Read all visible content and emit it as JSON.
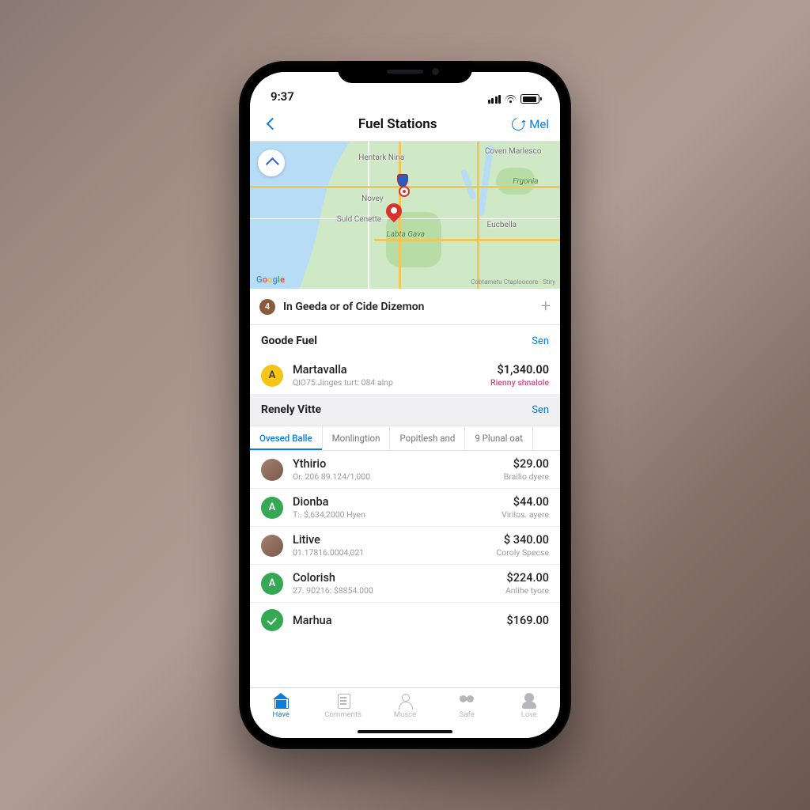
{
  "status": {
    "time": "9:37"
  },
  "header": {
    "title": "Fuel Stations",
    "action": "Mel"
  },
  "map": {
    "labels": {
      "l1": "Hentark Nina",
      "l2": "Coven Marlesco",
      "l3": "Novey",
      "l4": "Suld Cenette",
      "l5": "Eucbella",
      "p1": "Labta Gava",
      "p2": "Frgonia"
    },
    "logo": [
      "G",
      "o",
      "o",
      "g",
      "l",
      "e"
    ],
    "attribution": "Cobtametu Ctaploocore · Stiry"
  },
  "location": {
    "count": "4",
    "text": "In Geeda or of Cide Dizemon"
  },
  "section1": {
    "title": "Goode Fuel",
    "action": "Sen",
    "row": {
      "icon": "A",
      "title": "Martavalla",
      "sub": "QlO75:Jinges turt: 084 alnp",
      "price": "$1,340.00",
      "tag": "Rienny shnalole"
    }
  },
  "section2": {
    "title": "Renely Vitte",
    "action": "Sen"
  },
  "tabs": [
    "Ovesed Balle",
    "Monlingtion",
    "Popitlesh and",
    "9 Plunal oat"
  ],
  "list": [
    {
      "icon": "img",
      "title": "Ythirio",
      "sub": "Or. 206 89.124/1,000",
      "price": "$29.00",
      "tag": "Brailio dyere"
    },
    {
      "icon": "A",
      "color": "#34a853",
      "title": "Dionba",
      "sub": "T:. $,634,2000 Hyen",
      "price": "$44.00",
      "tag": "Virilos. ayere"
    },
    {
      "icon": "img",
      "title": "Litive",
      "sub": "01.17816.0004,021",
      "price": "$ 340.00",
      "tag": "Coroly Specse"
    },
    {
      "icon": "A",
      "color": "#34a853",
      "title": "Colorish",
      "sub": "27. 90216: $8854.000",
      "price": "$224.00",
      "tag": "Anlihe tyore"
    },
    {
      "icon": "check",
      "title": "Marhua",
      "sub": "",
      "price": "$169.00",
      "tag": ""
    }
  ],
  "tabbar": [
    {
      "icon": "home",
      "label": "Have",
      "active": true
    },
    {
      "icon": "doc",
      "label": "Comments"
    },
    {
      "icon": "user",
      "label": "Musce"
    },
    {
      "icon": "heart",
      "label": "Safe"
    },
    {
      "icon": "prof",
      "label": "Love"
    }
  ]
}
